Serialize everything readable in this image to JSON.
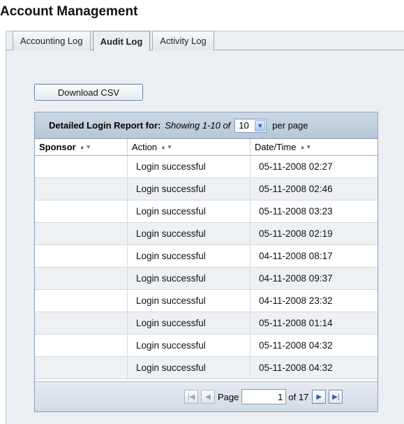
{
  "title": "Account Management",
  "tabs": [
    {
      "label": "Accounting Log",
      "active": false
    },
    {
      "label": "Audit Log",
      "active": true
    },
    {
      "label": "Activity Log",
      "active": false
    }
  ],
  "download_label": "Download CSV",
  "report": {
    "label": "Detailed Login Report for:",
    "showing": "Showing 1-10 of",
    "per_page_value": "10",
    "per_page_label": "per page"
  },
  "columns": [
    "Sponsor",
    "Action",
    "Date/Time"
  ],
  "rows": [
    {
      "sponsor": "",
      "action": "Login successful",
      "datetime": "05-11-2008 02:27"
    },
    {
      "sponsor": "",
      "action": "Login successful",
      "datetime": "05-11-2008 02:46"
    },
    {
      "sponsor": "",
      "action": "Login successful",
      "datetime": "05-11-2008 03:23"
    },
    {
      "sponsor": "",
      "action": "Login successful",
      "datetime": "05-11-2008 02:19"
    },
    {
      "sponsor": "",
      "action": "Login successful",
      "datetime": "04-11-2008 08:17"
    },
    {
      "sponsor": "",
      "action": "Login successful",
      "datetime": "04-11-2008 09:37"
    },
    {
      "sponsor": "",
      "action": "Login successful",
      "datetime": "04-11-2008 23:32"
    },
    {
      "sponsor": "",
      "action": "Login successful",
      "datetime": "05-11-2008 01:14"
    },
    {
      "sponsor": "",
      "action": "Login successful",
      "datetime": "05-11-2008 04:32"
    },
    {
      "sponsor": "",
      "action": "Login successful",
      "datetime": "05-11-2008 04:32"
    }
  ],
  "pager": {
    "page_label": "Page",
    "page_value": "1",
    "of_label": "of 17"
  },
  "icons": {
    "first": "first-page-icon",
    "prev": "previous-page-icon",
    "next": "next-page-icon",
    "last": "last-page-icon",
    "sort": "sort-arrows-icon",
    "dropdown": "chevron-down-icon"
  }
}
